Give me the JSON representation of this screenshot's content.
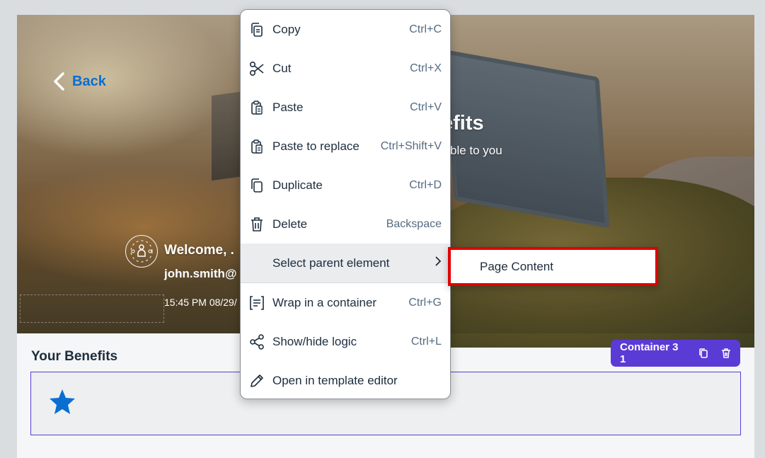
{
  "hero": {
    "back_label": "Back",
    "title_fragment": "efits",
    "subtitle_fragment": "ble to you",
    "welcome_text": "Welcome, .",
    "email_text": "john.smith@",
    "datetime_text": "15:45 PM 08/29/"
  },
  "section": {
    "title": "Your Benefits",
    "container_label": "Container 3 1"
  },
  "context_menu": {
    "items": [
      {
        "label": "Copy",
        "shortcut": "Ctrl+C",
        "icon": "copy-icon"
      },
      {
        "label": "Cut",
        "shortcut": "Ctrl+X",
        "icon": "scissors-icon"
      },
      {
        "label": "Paste",
        "shortcut": "Ctrl+V",
        "icon": "clipboard-icon"
      },
      {
        "label": "Paste to replace",
        "shortcut": "Ctrl+Shift+V",
        "icon": "clipboard-replace-icon"
      },
      {
        "label": "Duplicate",
        "shortcut": "Ctrl+D",
        "icon": "duplicate-icon"
      },
      {
        "label": "Delete",
        "shortcut": "Backspace",
        "icon": "trash-icon"
      },
      {
        "label": "Select parent element",
        "shortcut": "",
        "icon": "chevron-right-icon"
      },
      {
        "label": "Wrap in a container",
        "shortcut": "Ctrl+G",
        "icon": "wrap-container-icon"
      },
      {
        "label": "Show/hide logic",
        "shortcut": "Ctrl+L",
        "icon": "share-logic-icon"
      },
      {
        "label": "Open in template editor",
        "shortcut": "",
        "icon": "pencil-icon"
      }
    ],
    "submenu": {
      "label": "Page Content"
    }
  },
  "colors": {
    "accent": "#5b3bd6",
    "link": "#0a6ed1",
    "highlight_border": "#e00000",
    "star": "#0a6ed1"
  }
}
